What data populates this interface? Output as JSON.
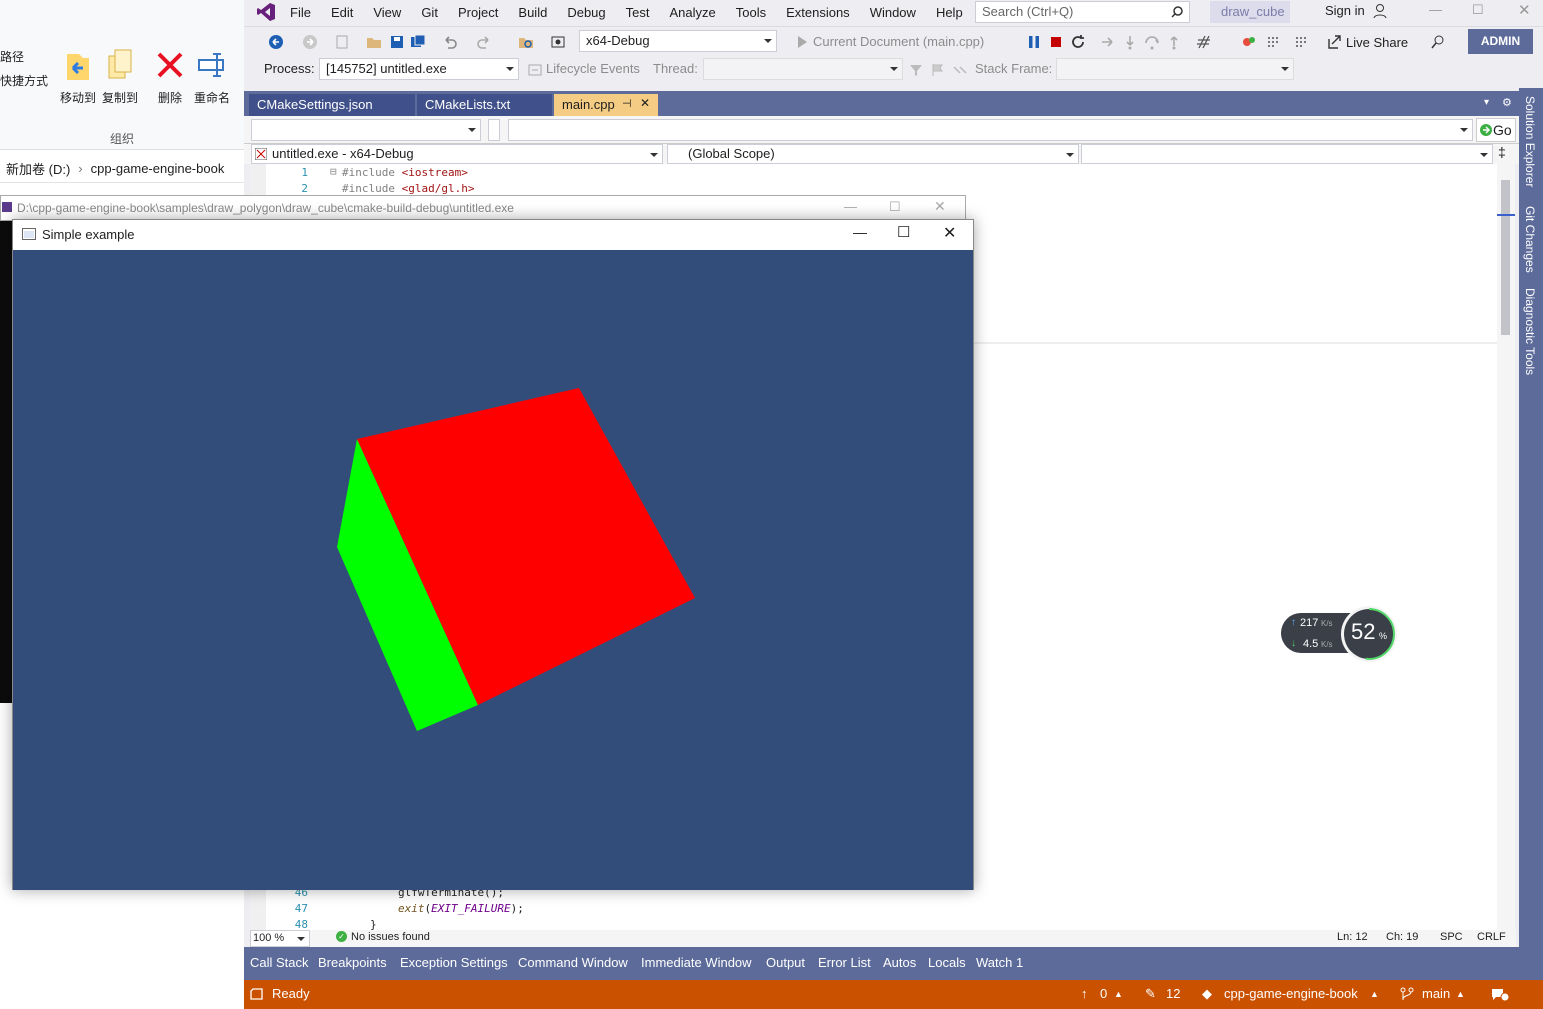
{
  "explorer": {
    "frag1": "路径",
    "frag2": "快捷方式",
    "move_to": "移动到",
    "copy_to": "复制到",
    "delete": "删除",
    "rename": "重命名",
    "group_label": "组织",
    "drive": "新加卷 (D:)",
    "folder": "cpp-game-engine-book"
  },
  "vs": {
    "menu": [
      "File",
      "Edit",
      "View",
      "Git",
      "Project",
      "Build",
      "Debug",
      "Test",
      "Analyze",
      "Tools",
      "Extensions",
      "Window",
      "Help"
    ],
    "search_placeholder": "Search (Ctrl+Q)",
    "solution_name": "draw_cube",
    "sign_in": "Sign in",
    "admin": "ADMIN",
    "config": "x64-Debug",
    "current_doc": "Current Document (main.cpp)",
    "live_share": "Live Share",
    "process_label": "Process:",
    "process_value": "[145752] untitled.exe",
    "lifecycle": "Lifecycle Events",
    "thread_label": "Thread:",
    "stack_frame_label": "Stack Frame:",
    "tabs": [
      "CMakeSettings.json",
      "CMakeLists.txt",
      "main.cpp"
    ],
    "go_label": "Go",
    "nav_project": "untitled.exe - x64-Debug",
    "nav_scope": "(Global Scope)",
    "code_top": [
      {
        "n": "1",
        "pre": "#include ",
        "inc": "<iostream>"
      },
      {
        "n": "2",
        "pre": "#include ",
        "inc": "<glad/gl.h>"
      }
    ],
    "code_bottom": [
      {
        "n": "46",
        "text": "glfwTerminate();"
      },
      {
        "n": "47",
        "fn": "exit",
        "arg": "EXIT_FAILURE",
        "tail": ");"
      },
      {
        "n": "48",
        "text": "}"
      }
    ],
    "zoom": "100 %",
    "issues": "No issues found",
    "ln": "Ln: 12",
    "ch": "Ch: 19",
    "spc": "SPC",
    "crlf": "CRLF",
    "tool_tabs": [
      "Call Stack",
      "Breakpoints",
      "Exception Settings",
      "Command Window",
      "Immediate Window",
      "Output",
      "Error List",
      "Autos",
      "Locals",
      "Watch 1"
    ],
    "status_ready": "Ready",
    "status_up": "0",
    "status_edits": "12",
    "status_repo": "cpp-game-engine-book",
    "status_branch": "main",
    "side_tabs": [
      "Solution Explorer",
      "Git Changes",
      "Diagnostic Tools"
    ]
  },
  "widget": {
    "upload": "217",
    "upload_unit": "K/s",
    "download": "4.5",
    "download_unit": "K/s",
    "percent": "52",
    "percent_sign": "%",
    "percent_value": 52
  },
  "console_window": {
    "title": "D:\\cpp-game-engine-book\\samples\\draw_polygon\\draw_cube\\cmake-build-debug\\untitled.exe"
  },
  "glfw_window": {
    "title": "Simple example",
    "clear_color": "#324d7a",
    "front_face_color": "#ff0000",
    "side_face_color": "#00ff00"
  },
  "colors": {
    "vs_accent": "#5c6b9a",
    "status_bar": "#ca5100",
    "active_tab": "#f5cc84"
  }
}
